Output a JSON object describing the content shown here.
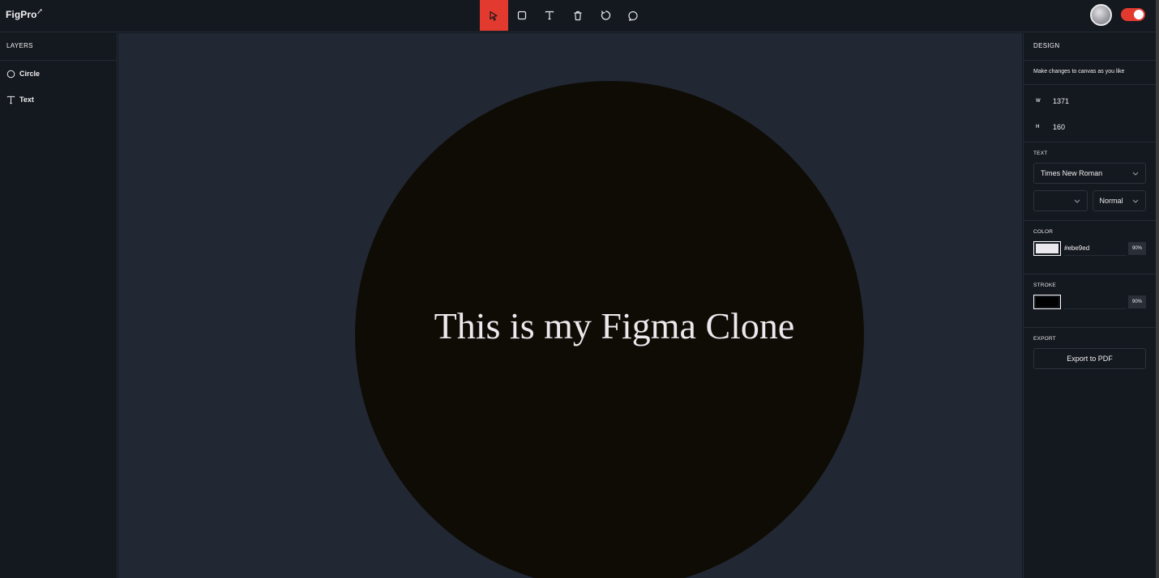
{
  "app": {
    "logo": "FigPro"
  },
  "toolbar": {
    "tools": [
      {
        "name": "select",
        "icon": "cursor-icon",
        "active": true
      },
      {
        "name": "rectangle",
        "icon": "square-icon"
      },
      {
        "name": "text",
        "icon": "text-icon"
      },
      {
        "name": "delete",
        "icon": "trash-icon"
      },
      {
        "name": "reset",
        "icon": "reset-icon"
      },
      {
        "name": "comments",
        "icon": "comment-icon"
      }
    ],
    "accent_color": "#e33a2f"
  },
  "layers": {
    "title": "LAYERS",
    "items": [
      {
        "label": "Circle",
        "icon": "circle-icon"
      },
      {
        "label": "Text",
        "icon": "text-icon"
      }
    ]
  },
  "canvas": {
    "background": "#212733",
    "circle_fill": "#0e0c04",
    "text": "This is my Figma Clone",
    "text_color": "#ebe9ed"
  },
  "design": {
    "title": "DESIGN",
    "subtitle": "Make changes to canvas as you like",
    "width_label": "W",
    "width_value": "1371",
    "height_label": "H",
    "height_value": "160",
    "text_section": {
      "title": "TEXT",
      "font_family": "Times New Roman",
      "font_size": "",
      "font_weight": "Normal"
    },
    "color_section": {
      "title": "COLOR",
      "swatch": "#ebe9ed",
      "hex": "#ebe9ed",
      "opacity": "90%"
    },
    "stroke_section": {
      "title": "STROKE",
      "swatch": "#000000",
      "hex": "",
      "opacity": "90%"
    },
    "export_section": {
      "title": "EXPORT",
      "button": "Export to PDF"
    }
  }
}
